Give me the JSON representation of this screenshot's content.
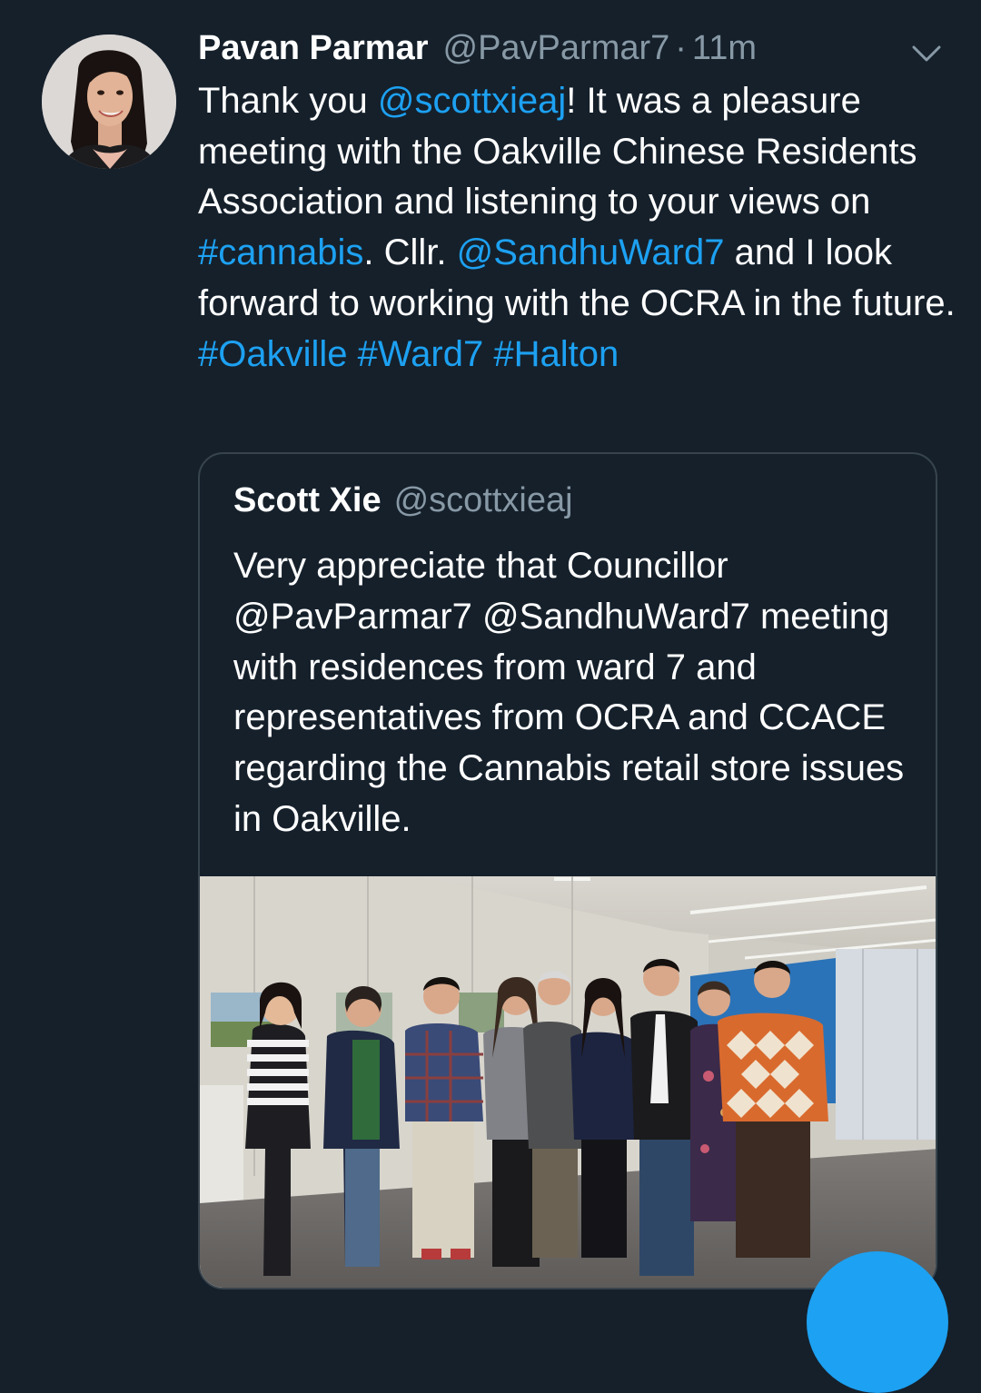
{
  "tweet": {
    "display_name": "Pavan Parmar",
    "handle": "@PavParmar7",
    "separator": "·",
    "time": "11m",
    "body": {
      "t1": "Thank you ",
      "m1": "@scottxieaj",
      "t2": "! It was a pleasure meeting with the Oakville Chinese Residents Association and listening to your views on ",
      "h1": "#cannabis",
      "t3": ". Cllr. ",
      "m2": "@SandhuWard7",
      "t4": " and I look forward to working with the OCRA in the future. ",
      "h2": "#Oakville",
      "h3": "#Ward7",
      "h4": "#Halton"
    },
    "icons": {
      "menu": "chevron-down-icon",
      "avatar": "profile-photo"
    }
  },
  "quoted_tweet": {
    "display_name": "Scott Xie",
    "handle": "@scottxieaj",
    "text": "Very appreciate that Councillor @PavParmar7 @SandhuWard7 meeting with residences from ward 7 and representatives from OCRA and CCACE regarding the Cannabis retail store issues in Oakville.",
    "media": "group-photo"
  },
  "colors": {
    "background": "#15202b",
    "link": "#1da1f2",
    "secondary_text": "#8899a6",
    "border": "#38444d",
    "fab": "#1da1f2"
  }
}
